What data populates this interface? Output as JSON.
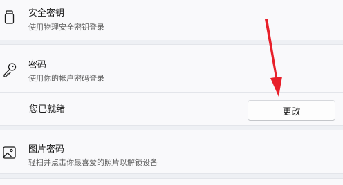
{
  "security_key": {
    "title": "安全密钥",
    "description": "使用物理安全密钥登录",
    "icon": "usb-key-icon"
  },
  "password": {
    "title": "密码",
    "description": "使用你的帐户密码登录",
    "icon": "key-icon"
  },
  "password_status": {
    "label": "您已就绪",
    "change_button": "更改"
  },
  "picture_password": {
    "title": "图片密码",
    "description": "轻扫并点击你最喜爱的照片以解锁设备",
    "icon": "picture-icon"
  },
  "colors": {
    "annotation_arrow": "#e8202a",
    "background": "#eef0f4",
    "card": "#f9f9fb"
  }
}
